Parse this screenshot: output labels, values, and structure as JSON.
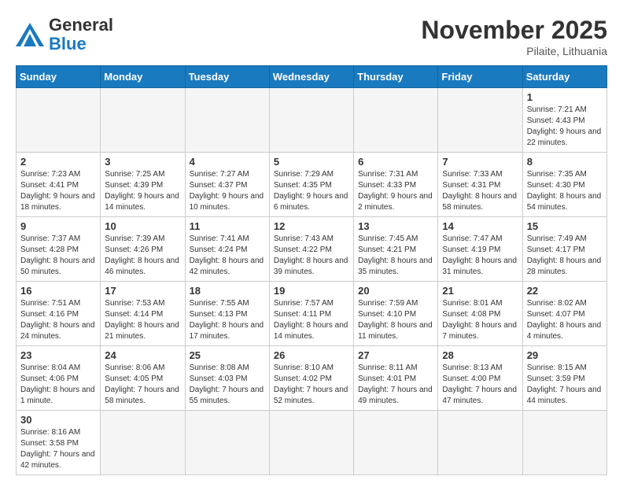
{
  "header": {
    "logo_general": "General",
    "logo_blue": "Blue",
    "month_title": "November 2025",
    "location": "Pilaite, Lithuania"
  },
  "weekdays": [
    "Sunday",
    "Monday",
    "Tuesday",
    "Wednesday",
    "Thursday",
    "Friday",
    "Saturday"
  ],
  "weeks": [
    [
      {
        "day": "",
        "info": ""
      },
      {
        "day": "",
        "info": ""
      },
      {
        "day": "",
        "info": ""
      },
      {
        "day": "",
        "info": ""
      },
      {
        "day": "",
        "info": ""
      },
      {
        "day": "",
        "info": ""
      },
      {
        "day": "1",
        "info": "Sunrise: 7:21 AM\nSunset: 4:43 PM\nDaylight: 9 hours and 22 minutes."
      }
    ],
    [
      {
        "day": "2",
        "info": "Sunrise: 7:23 AM\nSunset: 4:41 PM\nDaylight: 9 hours and 18 minutes."
      },
      {
        "day": "3",
        "info": "Sunrise: 7:25 AM\nSunset: 4:39 PM\nDaylight: 9 hours and 14 minutes."
      },
      {
        "day": "4",
        "info": "Sunrise: 7:27 AM\nSunset: 4:37 PM\nDaylight: 9 hours and 10 minutes."
      },
      {
        "day": "5",
        "info": "Sunrise: 7:29 AM\nSunset: 4:35 PM\nDaylight: 9 hours and 6 minutes."
      },
      {
        "day": "6",
        "info": "Sunrise: 7:31 AM\nSunset: 4:33 PM\nDaylight: 9 hours and 2 minutes."
      },
      {
        "day": "7",
        "info": "Sunrise: 7:33 AM\nSunset: 4:31 PM\nDaylight: 8 hours and 58 minutes."
      },
      {
        "day": "8",
        "info": "Sunrise: 7:35 AM\nSunset: 4:30 PM\nDaylight: 8 hours and 54 minutes."
      }
    ],
    [
      {
        "day": "9",
        "info": "Sunrise: 7:37 AM\nSunset: 4:28 PM\nDaylight: 8 hours and 50 minutes."
      },
      {
        "day": "10",
        "info": "Sunrise: 7:39 AM\nSunset: 4:26 PM\nDaylight: 8 hours and 46 minutes."
      },
      {
        "day": "11",
        "info": "Sunrise: 7:41 AM\nSunset: 4:24 PM\nDaylight: 8 hours and 42 minutes."
      },
      {
        "day": "12",
        "info": "Sunrise: 7:43 AM\nSunset: 4:22 PM\nDaylight: 8 hours and 39 minutes."
      },
      {
        "day": "13",
        "info": "Sunrise: 7:45 AM\nSunset: 4:21 PM\nDaylight: 8 hours and 35 minutes."
      },
      {
        "day": "14",
        "info": "Sunrise: 7:47 AM\nSunset: 4:19 PM\nDaylight: 8 hours and 31 minutes."
      },
      {
        "day": "15",
        "info": "Sunrise: 7:49 AM\nSunset: 4:17 PM\nDaylight: 8 hours and 28 minutes."
      }
    ],
    [
      {
        "day": "16",
        "info": "Sunrise: 7:51 AM\nSunset: 4:16 PM\nDaylight: 8 hours and 24 minutes."
      },
      {
        "day": "17",
        "info": "Sunrise: 7:53 AM\nSunset: 4:14 PM\nDaylight: 8 hours and 21 minutes."
      },
      {
        "day": "18",
        "info": "Sunrise: 7:55 AM\nSunset: 4:13 PM\nDaylight: 8 hours and 17 minutes."
      },
      {
        "day": "19",
        "info": "Sunrise: 7:57 AM\nSunset: 4:11 PM\nDaylight: 8 hours and 14 minutes."
      },
      {
        "day": "20",
        "info": "Sunrise: 7:59 AM\nSunset: 4:10 PM\nDaylight: 8 hours and 11 minutes."
      },
      {
        "day": "21",
        "info": "Sunrise: 8:01 AM\nSunset: 4:08 PM\nDaylight: 8 hours and 7 minutes."
      },
      {
        "day": "22",
        "info": "Sunrise: 8:02 AM\nSunset: 4:07 PM\nDaylight: 8 hours and 4 minutes."
      }
    ],
    [
      {
        "day": "23",
        "info": "Sunrise: 8:04 AM\nSunset: 4:06 PM\nDaylight: 8 hours and 1 minute."
      },
      {
        "day": "24",
        "info": "Sunrise: 8:06 AM\nSunset: 4:05 PM\nDaylight: 7 hours and 58 minutes."
      },
      {
        "day": "25",
        "info": "Sunrise: 8:08 AM\nSunset: 4:03 PM\nDaylight: 7 hours and 55 minutes."
      },
      {
        "day": "26",
        "info": "Sunrise: 8:10 AM\nSunset: 4:02 PM\nDaylight: 7 hours and 52 minutes."
      },
      {
        "day": "27",
        "info": "Sunrise: 8:11 AM\nSunset: 4:01 PM\nDaylight: 7 hours and 49 minutes."
      },
      {
        "day": "28",
        "info": "Sunrise: 8:13 AM\nSunset: 4:00 PM\nDaylight: 7 hours and 47 minutes."
      },
      {
        "day": "29",
        "info": "Sunrise: 8:15 AM\nSunset: 3:59 PM\nDaylight: 7 hours and 44 minutes."
      }
    ],
    [
      {
        "day": "30",
        "info": "Sunrise: 8:16 AM\nSunset: 3:58 PM\nDaylight: 7 hours and 42 minutes."
      },
      {
        "day": "",
        "info": ""
      },
      {
        "day": "",
        "info": ""
      },
      {
        "day": "",
        "info": ""
      },
      {
        "day": "",
        "info": ""
      },
      {
        "day": "",
        "info": ""
      },
      {
        "day": "",
        "info": ""
      }
    ]
  ]
}
